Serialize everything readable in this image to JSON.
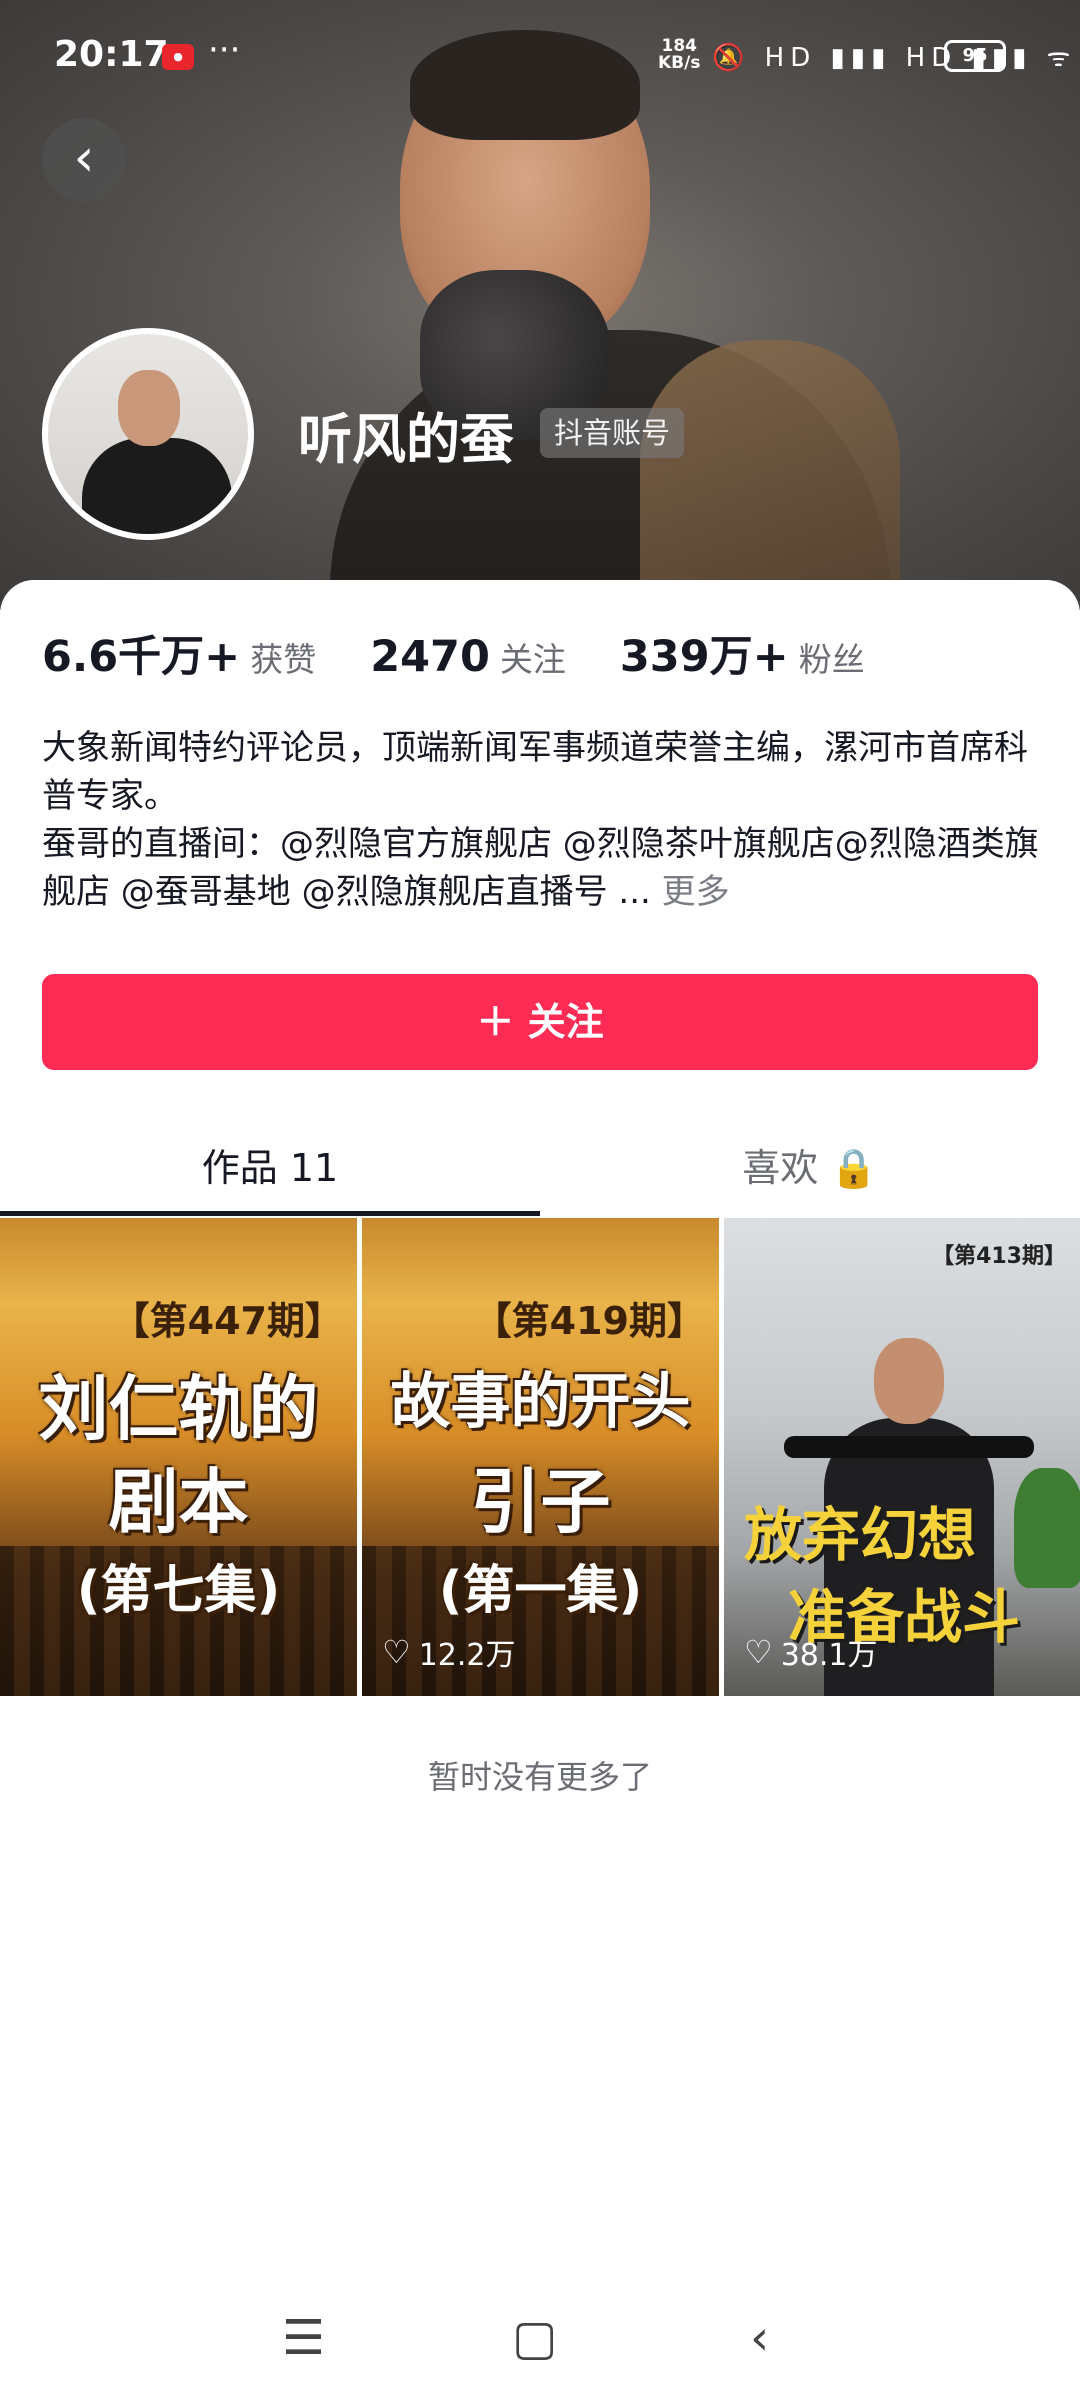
{
  "status_bar": {
    "time": "20:17",
    "net_speed": "184",
    "net_unit": "KB/s",
    "signal_icons": "🔕 HD ▮▮▮ HD ▮▮▮ ᯤ",
    "battery": "95"
  },
  "profile": {
    "name": "听风的蚕",
    "account_tag": "抖音账号",
    "stats": [
      {
        "value": "6.6千万+",
        "label": "获赞"
      },
      {
        "value": "2470",
        "label": "关注"
      },
      {
        "value": "339万+",
        "label": "粉丝"
      }
    ],
    "bio_line1": "大象新闻特约评论员，顶端新闻军事频道荣誉主编，漯河市首席科普专家。",
    "bio_line2": "蚕哥的直播间：@烈隐官方旗舰店 @烈隐茶叶旗舰店@烈隐酒类旗舰店 @蚕哥基地 @烈隐旗舰店直播号 ...",
    "bio_more": "更多"
  },
  "follow_button": "＋ 关注",
  "tabs": [
    {
      "label": "作品 11"
    },
    {
      "label": "喜欢 🔒"
    }
  ],
  "videos": [
    {
      "episode": "【第447期】",
      "title_line1": "刘仁轨的",
      "title_line2": "剧本",
      "title_line3": "(第七集)",
      "likes": ""
    },
    {
      "episode": "【第419期】",
      "title_line1": "故事的开头",
      "title_line2": "引子",
      "title_line3": "(第一集)",
      "likes": "12.2万"
    },
    {
      "episode": "【第413期】",
      "title_line1": "放弃幻想",
      "title_line2": "准备战斗",
      "likes": "38.1万"
    }
  ],
  "end_text": "暂时没有更多了",
  "colors": {
    "accent": "#fe2c55",
    "text": "#161823",
    "secondary": "#6b6d74"
  }
}
